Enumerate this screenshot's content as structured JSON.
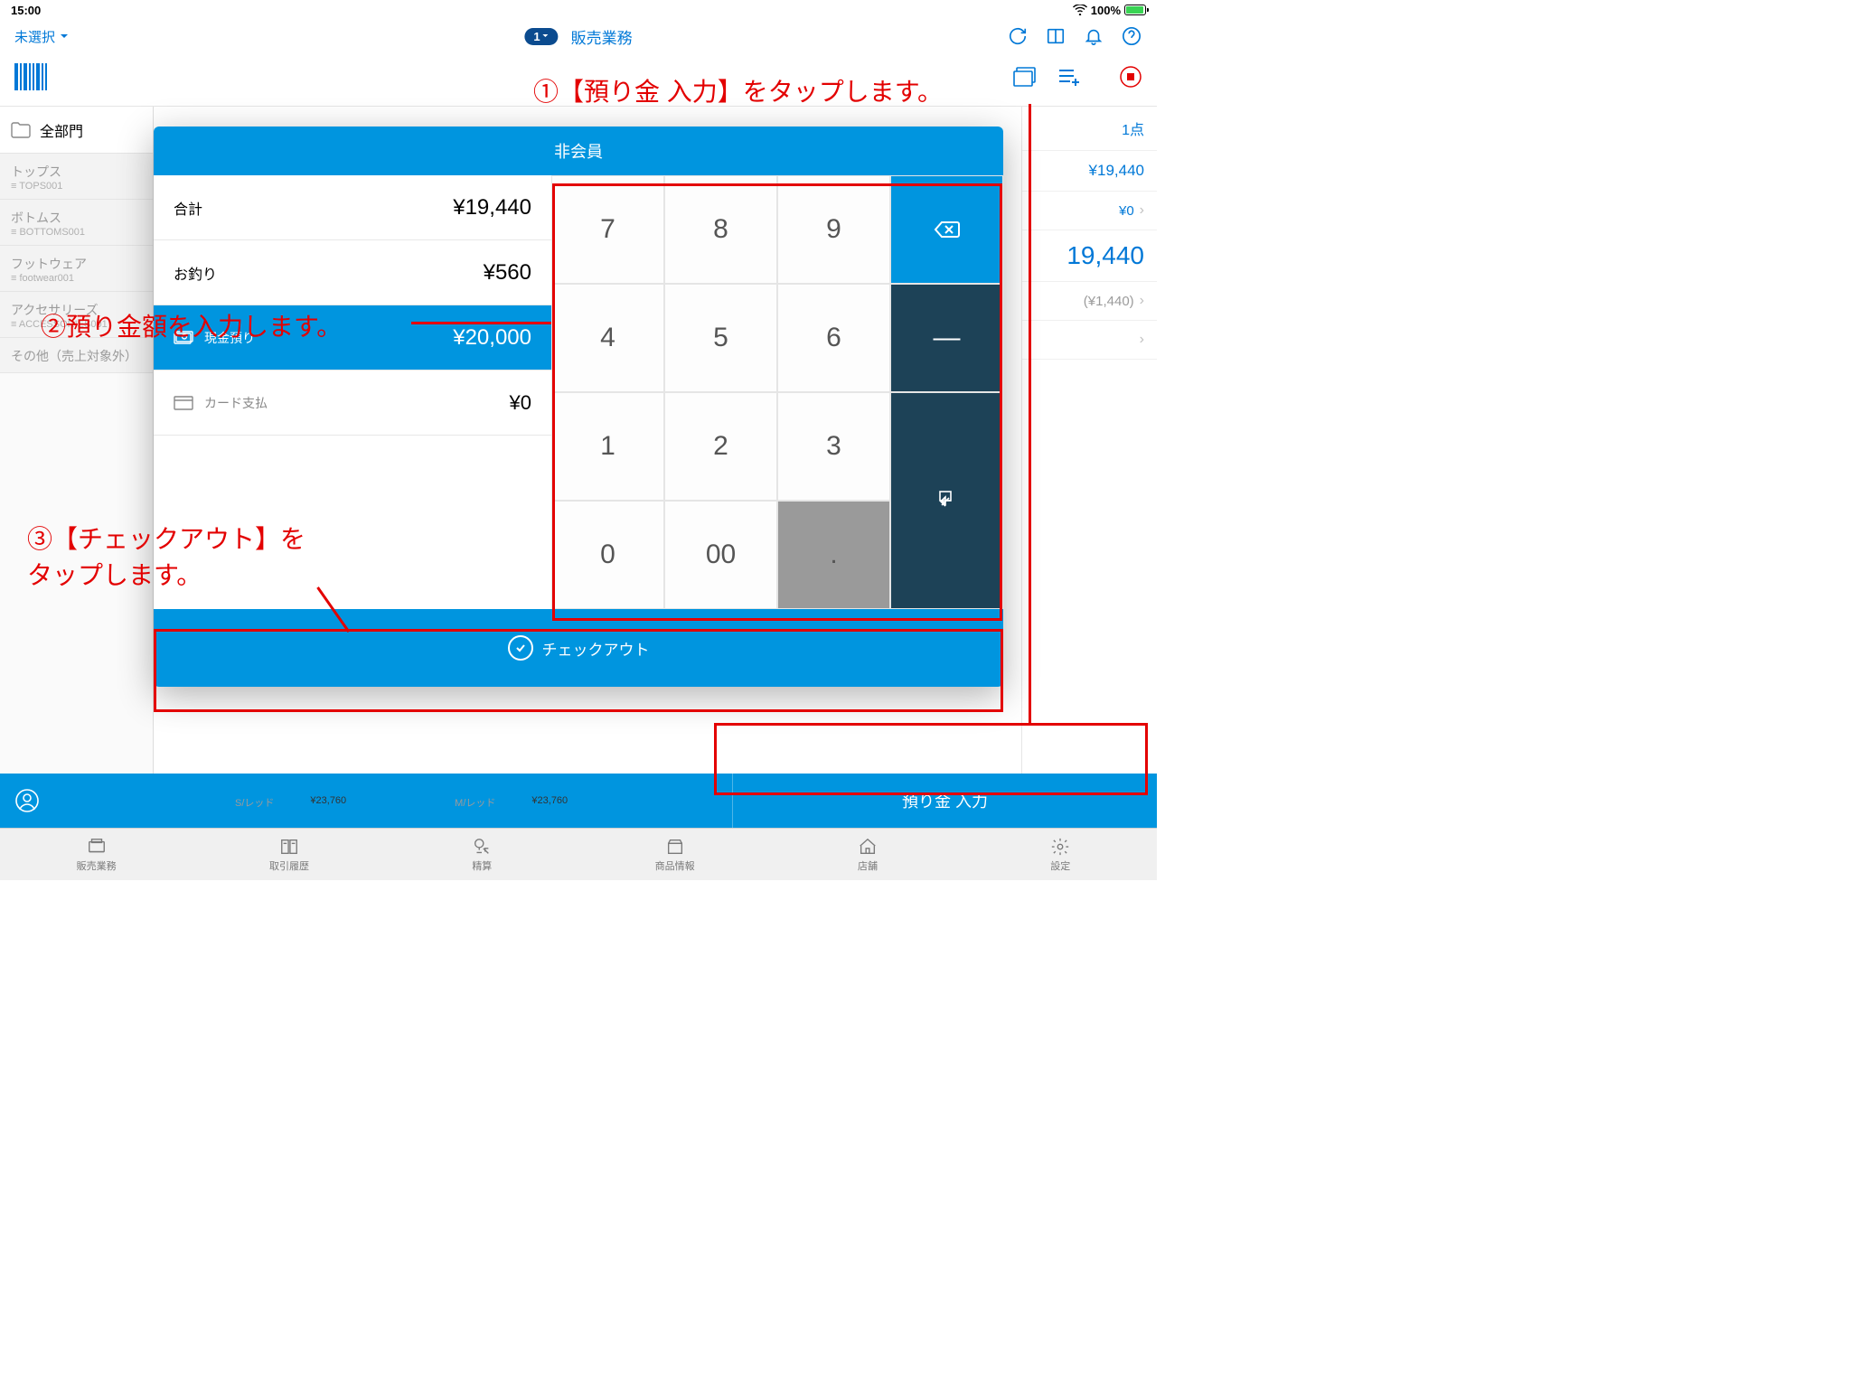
{
  "status": {
    "time": "15:00",
    "battery": "100%"
  },
  "topbar": {
    "dropdown": "未選択",
    "badge": "1",
    "title": "販売業務"
  },
  "sidebar": {
    "all": "全部門",
    "cats": [
      {
        "name": "トップス",
        "code": "≡ TOPS001"
      },
      {
        "name": "ボトムス",
        "code": "≡ BOTTOMS001"
      },
      {
        "name": "フットウェア",
        "code": "≡ footwear001"
      },
      {
        "name": "アクセサリーズ",
        "code": "≡ ACCESSORIES001"
      },
      {
        "name": "その他（売上対象外）",
        "code": ""
      }
    ]
  },
  "rightpane": {
    "count": "1点",
    "amount": "¥19,440",
    "sub": "¥0",
    "big": "19,440",
    "paren": "(¥1,440)"
  },
  "bottombar": {
    "action": "預り金 入力"
  },
  "tabs": [
    "販売業務",
    "取引履歴",
    "精算",
    "商品情報",
    "店舗",
    "設定"
  ],
  "modal": {
    "header": "非会員",
    "total_label": "合計",
    "total_val": "¥19,440",
    "change_label": "お釣り",
    "change_val": "¥560",
    "cash_label": "現金預り",
    "cash_val": "¥20,000",
    "card_label": "カード支払",
    "card_val": "¥0",
    "keys": [
      "7",
      "8",
      "9",
      "4",
      "5",
      "6",
      "1",
      "2",
      "3",
      "0",
      "00",
      "."
    ],
    "checkout": "チェックアウト"
  },
  "annotations": {
    "a1": "①【預り金 入力】をタップします。",
    "a2": "②預り金額を入力します。",
    "a3": "③【チェックアウト】を\nタップします。"
  },
  "peek": {
    "c1": "S/レッド",
    "p1": "¥23,760",
    "c2": "M/レッド",
    "p2": "¥23,760"
  }
}
